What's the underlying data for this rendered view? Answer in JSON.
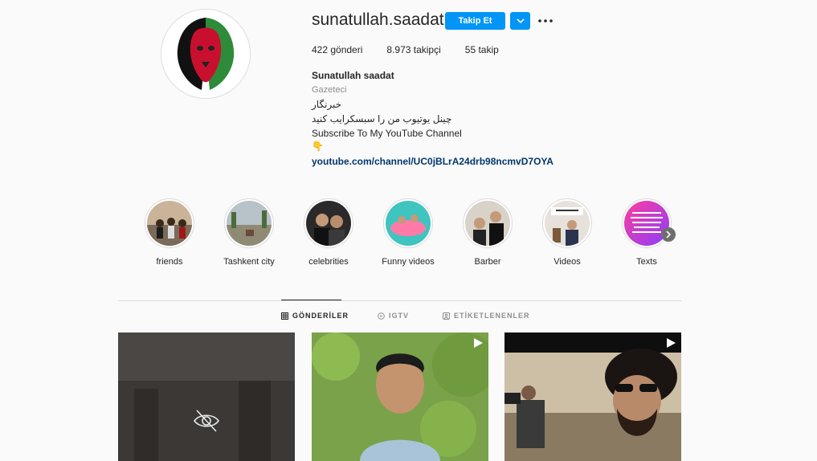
{
  "profile": {
    "username": "sunatullah.saadat",
    "follow_label": "Takip Et",
    "stats": {
      "posts": "422 gönderi",
      "followers": "8.973 takipçi",
      "following": "55 takip"
    },
    "full_name": "Sunatullah saadat",
    "category": "Gazeteci",
    "bio": [
      "خبرنگار",
      "چینل یوتیوب من را سبسکرایب کنید",
      "Subscribe To My YouTube Channel",
      "👇"
    ],
    "link": "youtube.com/channel/UC0jBLrA24drb98ncmvD7OYA",
    "avatar_icon": "lion-flag-avatar"
  },
  "highlights": [
    {
      "label": "friends"
    },
    {
      "label": "Tashkent city"
    },
    {
      "label": "celebrities"
    },
    {
      "label": "Funny videos"
    },
    {
      "label": "Barber"
    },
    {
      "label": "Videos"
    },
    {
      "label": "Texts"
    }
  ],
  "tabs": {
    "posts": "GÖNDERİLER",
    "igtv": "IGTV",
    "tagged": "ETİKETLENENLER"
  },
  "posts": [
    {
      "type": "hidden",
      "icon": "eye-slash-icon"
    },
    {
      "type": "video",
      "icon": "play-icon"
    },
    {
      "type": "video",
      "icon": "play-icon"
    }
  ],
  "colors": {
    "accent": "#0095f6",
    "link": "#00376b",
    "muted": "#8e8e8e",
    "background": "#fafafa"
  }
}
